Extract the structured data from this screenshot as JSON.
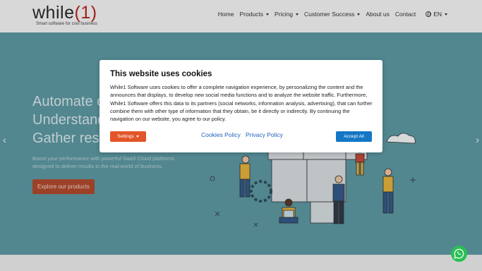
{
  "header": {
    "logo_text": "while",
    "logo_paren_open": "(",
    "logo_one": "1",
    "logo_paren_close": ")",
    "tagline": "Smart software for cool business",
    "nav": [
      {
        "label": "Home",
        "has_caret": false
      },
      {
        "label": "Products",
        "has_caret": true
      },
      {
        "label": "Pricing",
        "has_caret": true
      },
      {
        "label": "Customer Success",
        "has_caret": true
      },
      {
        "label": "About us",
        "has_caret": false
      },
      {
        "label": "Contact",
        "has_caret": false
      }
    ],
    "language": "EN"
  },
  "hero": {
    "title_line1": "Automate c",
    "title_line2": "Understand",
    "title_line3": "Gather resu",
    "subtitle_line1": "Boost your performance with powerful SaaS Cloud platforms",
    "subtitle_line2": "designed to deliver results in the real-world of business.",
    "cta": "Explore our products",
    "prev_arrow": "‹",
    "next_arrow": "›",
    "bg_color": "#5e9aa4"
  },
  "cookie_modal": {
    "title": "This website uses cookies",
    "body": "While1 Software uses cookies to offer a complete navigation experience, by personalizing the content and the announces that displays, to develop new social media functions and to analyze the website traffic. Furthermore, While1 Software offers this data to its partners (social networks, information analysis, advertising), that can further combine them with other type of information that they obtain, be it directly or indirectly. By continuing the navigation on our website, you agree to our policy.",
    "settings_label": "Settings",
    "cookies_policy_label": "Cookies Policy",
    "privacy_policy_label": "Privacy Policy",
    "accept_label": "Accept All",
    "settings_color": "#e2552a",
    "accept_color": "#1576c5"
  },
  "floating": {
    "whatsapp_icon": "whatsapp-icon"
  }
}
